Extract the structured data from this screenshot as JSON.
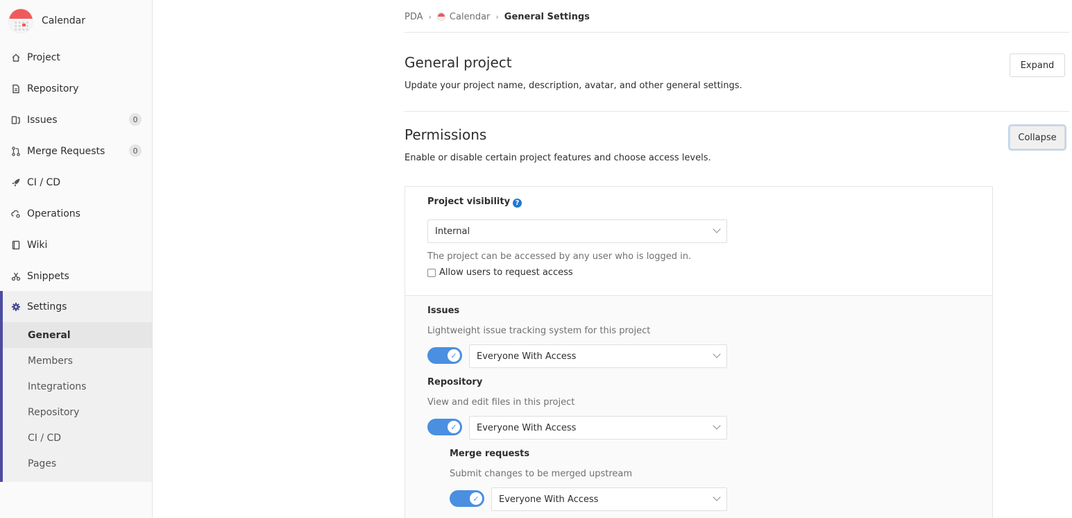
{
  "sidebar": {
    "project_name": "Calendar",
    "items": [
      {
        "label": "Project",
        "icon": "home-icon"
      },
      {
        "label": "Repository",
        "icon": "doc-icon"
      },
      {
        "label": "Issues",
        "icon": "issues-icon",
        "badge": "0"
      },
      {
        "label": "Merge Requests",
        "icon": "merge-icon",
        "badge": "0"
      },
      {
        "label": "CI / CD",
        "icon": "rocket-icon"
      },
      {
        "label": "Operations",
        "icon": "cloud-gear-icon"
      },
      {
        "label": "Wiki",
        "icon": "book-icon"
      },
      {
        "label": "Snippets",
        "icon": "scissors-icon"
      }
    ],
    "settings": {
      "label": "Settings",
      "sub_items": [
        "General",
        "Members",
        "Integrations",
        "Repository",
        "CI / CD",
        "Pages"
      ]
    }
  },
  "breadcrumb": {
    "items": [
      "PDA",
      "Calendar",
      "General Settings"
    ]
  },
  "sections": {
    "general": {
      "title": "General project",
      "description": "Update your project name, description, avatar, and other general settings.",
      "button": "Expand"
    },
    "permissions": {
      "title": "Permissions",
      "description": "Enable or disable certain project features and choose access levels.",
      "button": "Collapse",
      "visibility": {
        "label": "Project visibility",
        "value": "Internal",
        "help": "The project can be accessed by any user who is logged in.",
        "checkbox_label": "Allow users to request access"
      },
      "features": [
        {
          "label": "Issues",
          "help": "Lightweight issue tracking system for this project",
          "value": "Everyone With Access"
        },
        {
          "label": "Repository",
          "help": "View and edit files in this project",
          "value": "Everyone With Access"
        },
        {
          "label": "Merge requests",
          "help": "Submit changes to be merged upstream",
          "value": "Everyone With Access"
        }
      ]
    }
  },
  "colors": {
    "accent": "#4b4ba3",
    "toggle": "#4a8fe0",
    "brand_red": "#f05a5a"
  }
}
